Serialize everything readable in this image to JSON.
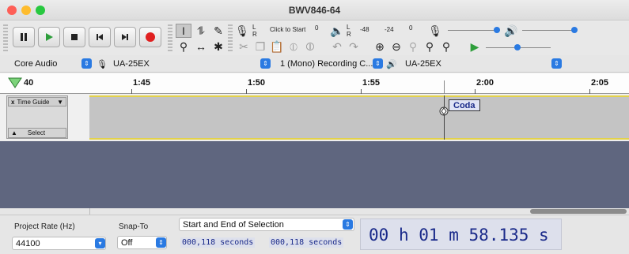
{
  "window": {
    "title": "BWV846-64"
  },
  "transport": {
    "record_meter_label": "Click to Start",
    "meter_zero": "0",
    "meter_minus48": "-48",
    "meter_minus24": "-24",
    "channel_l": "L",
    "channel_r": "R"
  },
  "devices": {
    "host": "Core Audio",
    "recording_device": "UA-25EX",
    "channels": "1 (Mono) Recording C...",
    "playback_device": "UA-25EX"
  },
  "ruler": {
    "labels": [
      "40",
      "1:45",
      "1:50",
      "1:55",
      "2:00",
      "2:05"
    ]
  },
  "track": {
    "name": "Time Guide",
    "close": "x",
    "select_label": "Select",
    "label_text": "Coda"
  },
  "selection_bar": {
    "project_rate_label": "Project Rate (Hz)",
    "project_rate_value": "44100",
    "snap_to_label": "Snap-To",
    "snap_to_value": "Off",
    "selection_mode": "Start and End of Selection",
    "start_time": "000,118 seconds",
    "end_time": "000,118 seconds",
    "audio_position": {
      "hours": "00",
      "h_unit": "h",
      "minutes": "01",
      "m_unit": "m",
      "seconds": "58.135",
      "s_unit": "s"
    }
  },
  "colors": {
    "track_border": "#e3d24a",
    "empty_area": "#5f667f",
    "accent": "#2a7ae2",
    "time_text": "#1a2a8a"
  }
}
